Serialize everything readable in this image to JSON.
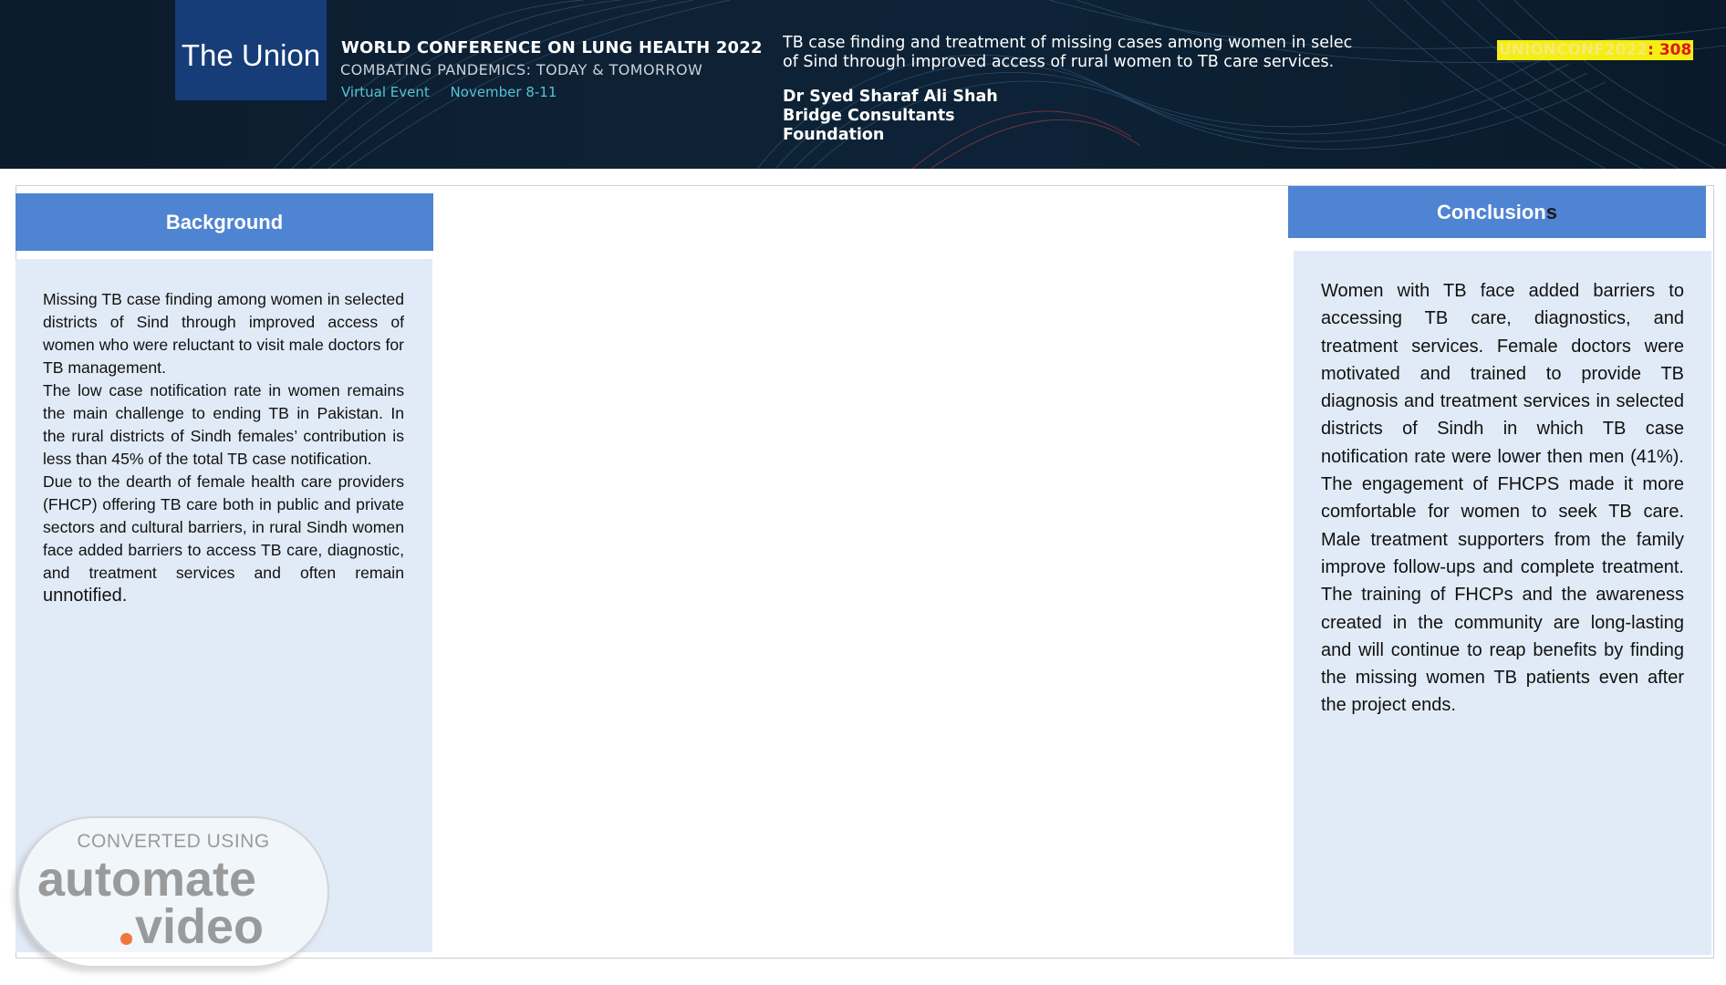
{
  "header": {
    "logo_text": "The Union",
    "conference_title": "WORLD CONFERENCE ON LUNG HEALTH 2022",
    "conference_subtitle": "COMBATING PANDEMICS: TODAY & TOMORROW",
    "event_type": "Virtual Event",
    "event_dates": "November 8-11",
    "talk_title_line1": "TB case finding and treatment of missing cases among women in selec",
    "talk_title_line2": "of Sind through improved access of rural women to TB care services.",
    "author_name": "Dr Syed Sharaf Ali Shah",
    "author_org_line1": "Bridge Consultants",
    "author_org_line2": "Foundation",
    "badge_code": "UNIONCONF2022",
    "badge_number": ": 308"
  },
  "background": {
    "heading": "Background",
    "paragraphs": [
      "Missing TB case finding among women in selected districts of Sind through improved access of women who were reluctant to visit male doctors for TB management.",
      "The low case notification rate in women remains the main challenge to ending TB in Pakistan. In the rural districts of Sindh females’ contribution is less than 45% of the total TB case notification."
    ],
    "para3_main": "Due to the dearth of female health care providers (FHCP) offering TB care both in public and private sectors and cultural barriers, in rural Sindh women face added barriers to access TB care, diagnostic, and treatment services and often remain ",
    "para3_end": "unnotified."
  },
  "conclusions": {
    "heading_main": "Conclusion",
    "heading_tail": "s",
    "paragraph": "Women with TB face added barriers to accessing TB care, diagnostics, and treatment services. Female doctors were motivated and trained to provide TB diagnosis and treatment services in selected districts of Sindh in which TB case notification rate were lower then men (41%). The engagement of FHCPS made it more comfortable for women to seek TB care. Male treatment supporters from the family improve follow-ups and complete treatment. The training of FHCPs and the awareness created in the community are long-lasting and will continue to reap benefits by finding the missing women TB patients even after the project ends."
  },
  "watermark": {
    "line1": "CONVERTED USING",
    "line2": "automate",
    "line3": ".video"
  },
  "colors": {
    "banner_bg": "#0d2236",
    "logo_bg": "#163d78",
    "section_header": "#4f84d3",
    "panel_bg": "#e1ebf7",
    "accent_teal": "#56c3d6",
    "badge_yellow": "#f4ef10",
    "badge_red": "#e0141b"
  }
}
